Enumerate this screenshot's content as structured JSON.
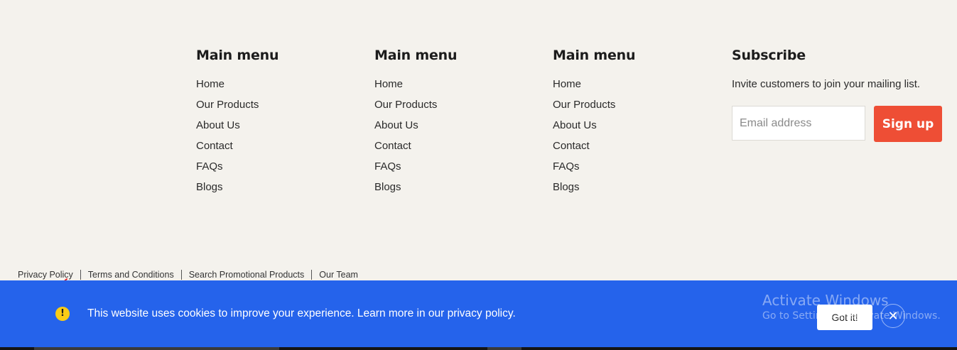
{
  "footer": {
    "columns": [
      {
        "title": "Main menu",
        "items": [
          "Home",
          "Our Products",
          "About Us",
          "Contact",
          "FAQs",
          "Blogs"
        ]
      },
      {
        "title": "Main menu",
        "items": [
          "Home",
          "Our Products",
          "About Us",
          "Contact",
          "FAQs",
          "Blogs"
        ]
      },
      {
        "title": "Main menu",
        "items": [
          "Home",
          "Our Products",
          "About Us",
          "Contact",
          "FAQs",
          "Blogs"
        ]
      }
    ],
    "subscribe": {
      "title": "Subscribe",
      "text": "Invite customers to join your mailing list.",
      "email_placeholder": "Email address",
      "button_label": "Sign up"
    },
    "legal_links": [
      "Privacy Policy",
      "Terms and Conditions",
      "Search Promotional Products",
      "Our Team"
    ]
  },
  "cookie_banner": {
    "icon": "warning-icon",
    "icon_glyph": "!",
    "message": "This website uses cookies to improve your experience. Learn more in our privacy policy.",
    "accept_label": "Got it!",
    "close_glyph": "✕"
  },
  "watermark": {
    "title": "Activate Windows",
    "subtitle": "Go to Settings to activate Windows."
  },
  "colors": {
    "background": "#f4f2ed",
    "accent": "#ee4e35",
    "banner": "#2563eb",
    "warning": "#facc15"
  }
}
